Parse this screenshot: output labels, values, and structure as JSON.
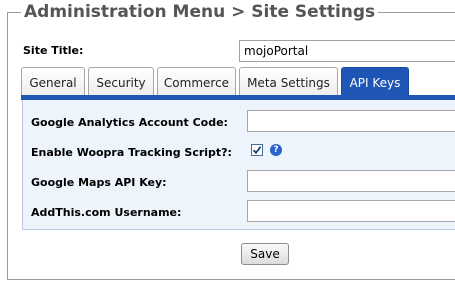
{
  "header": {
    "title": "Administration Menu > Site Settings"
  },
  "site_title": {
    "label": "Site Title:",
    "value": "mojoPortal"
  },
  "tabs": [
    {
      "label": "General",
      "active": false
    },
    {
      "label": "Security",
      "active": false
    },
    {
      "label": "Commerce",
      "active": false
    },
    {
      "label": "Meta Settings",
      "active": false
    },
    {
      "label": "API Keys",
      "active": true
    }
  ],
  "api_keys": {
    "google_analytics": {
      "label": "Google Analytics Account Code:",
      "value": ""
    },
    "woopra": {
      "label": "Enable Woopra Tracking Script?:",
      "checked": true,
      "help_icon": "help-icon"
    },
    "google_maps": {
      "label": "Google Maps API Key:",
      "value": ""
    },
    "addthis": {
      "label": "AddThis.com Username:",
      "value": ""
    }
  },
  "actions": {
    "save_label": "Save"
  },
  "colors": {
    "accent": "#1f56b6",
    "panel_bg": "#eef4fc",
    "legend_text": "#555555"
  }
}
